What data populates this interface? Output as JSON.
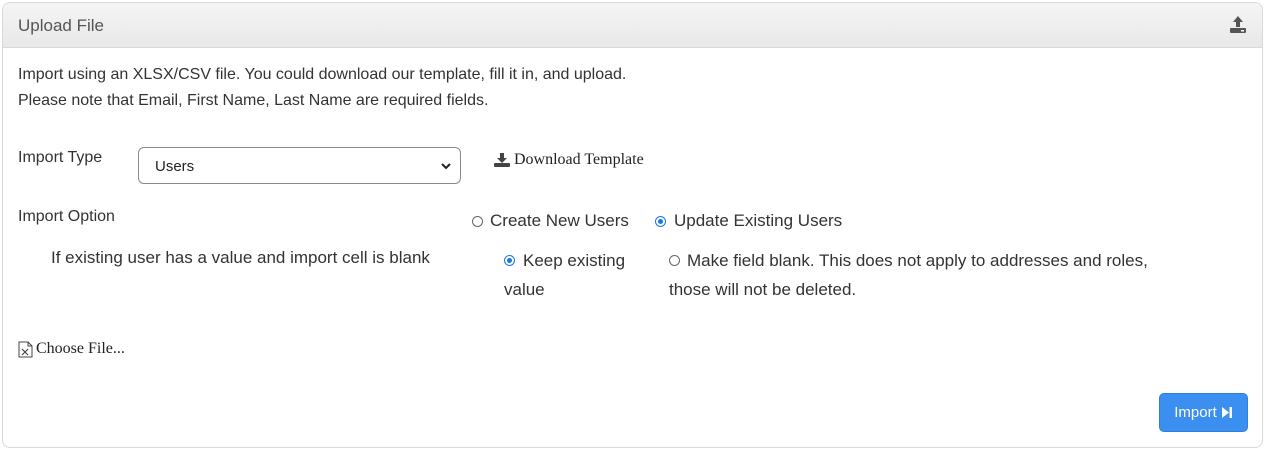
{
  "panel": {
    "title": "Upload File",
    "upload_icon": "upload-icon"
  },
  "description": {
    "line1": "Import using an XLSX/CSV file. You could download our template, fill it in, and upload.",
    "line2": "Please note that Email, First Name, Last Name are required fields."
  },
  "import_type": {
    "label": "Import Type",
    "selected": "Users",
    "download_label": "Download Template"
  },
  "import_option": {
    "label": "Import Option",
    "options": [
      {
        "label": "Create New Users",
        "checked": false
      },
      {
        "label": "Update Existing Users",
        "checked": true
      }
    ]
  },
  "blank_handling": {
    "label": "If existing user has a value and import cell is blank",
    "keep": {
      "line1": "Keep existing",
      "line2": "value",
      "checked": true
    },
    "blank": {
      "line1": "Make field blank. This does not apply to addresses and roles,",
      "line2": "those will not be deleted.",
      "checked": false
    }
  },
  "file": {
    "choose_label": "Choose File..."
  },
  "actions": {
    "import_label": "Import"
  },
  "colors": {
    "accent": "#3b8ff0",
    "radio_selected": "#1a73e8"
  }
}
